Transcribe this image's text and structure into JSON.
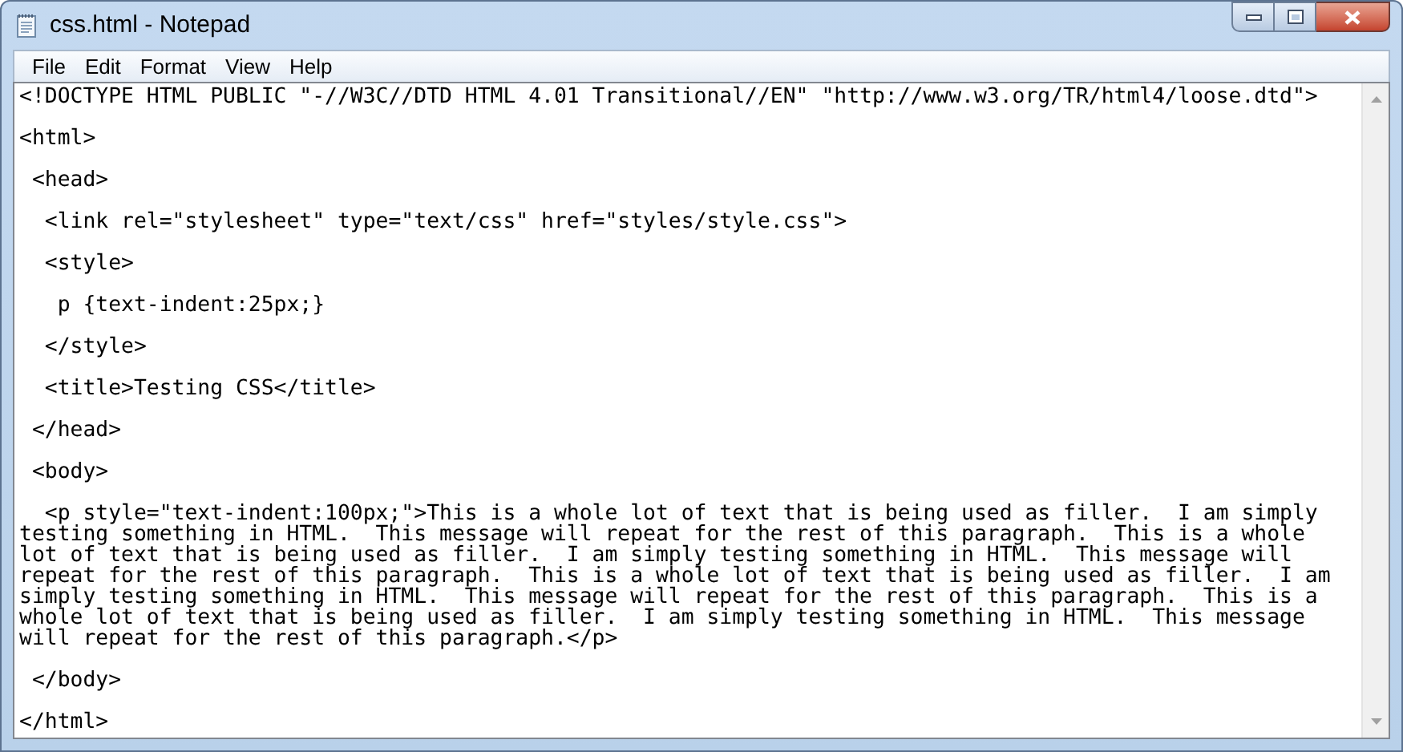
{
  "window": {
    "title": "css.html - Notepad"
  },
  "menu": [
    {
      "label": "File"
    },
    {
      "label": "Edit"
    },
    {
      "label": "Format"
    },
    {
      "label": "View"
    },
    {
      "label": "Help"
    }
  ],
  "document": {
    "blocks": [
      {
        "lines": [
          "<!DOCTYPE HTML PUBLIC \"-//W3C//DTD HTML 4.01 Transitional//EN\" \"http://www.w3.org/TR/html4/loose.dtd\">"
        ]
      },
      {
        "lines": [
          "<html>"
        ]
      },
      {
        "lines": [
          " <head>"
        ]
      },
      {
        "lines": [
          "  <link rel=\"stylesheet\" type=\"text/css\" href=\"styles/style.css\">"
        ]
      },
      {
        "lines": [
          "  <style>"
        ]
      },
      {
        "lines": [
          "   p {text-indent:25px;}"
        ]
      },
      {
        "lines": [
          "  </style>"
        ]
      },
      {
        "lines": [
          "  <title>Testing CSS</title>"
        ]
      },
      {
        "lines": [
          " </head>"
        ]
      },
      {
        "lines": [
          " <body>"
        ]
      },
      {
        "lines": [
          "  <p style=\"text-indent:100px;\">This is a whole lot of text that is being used as filler.  I am simply",
          "testing something in HTML.  This message will repeat for the rest of this paragraph.  This is a whole",
          "lot of text that is being used as filler.  I am simply testing something in HTML.  This message will",
          "repeat for the rest of this paragraph.  This is a whole lot of text that is being used as filler.  I am",
          "simply testing something in HTML.  This message will repeat for the rest of this paragraph.  This is a",
          "whole lot of text that is being used as filler.  I am simply testing something in HTML.  This message",
          "will repeat for the rest of this paragraph.</p>"
        ]
      },
      {
        "lines": [
          " </body>"
        ]
      },
      {
        "lines": [
          "</html>"
        ]
      }
    ]
  }
}
